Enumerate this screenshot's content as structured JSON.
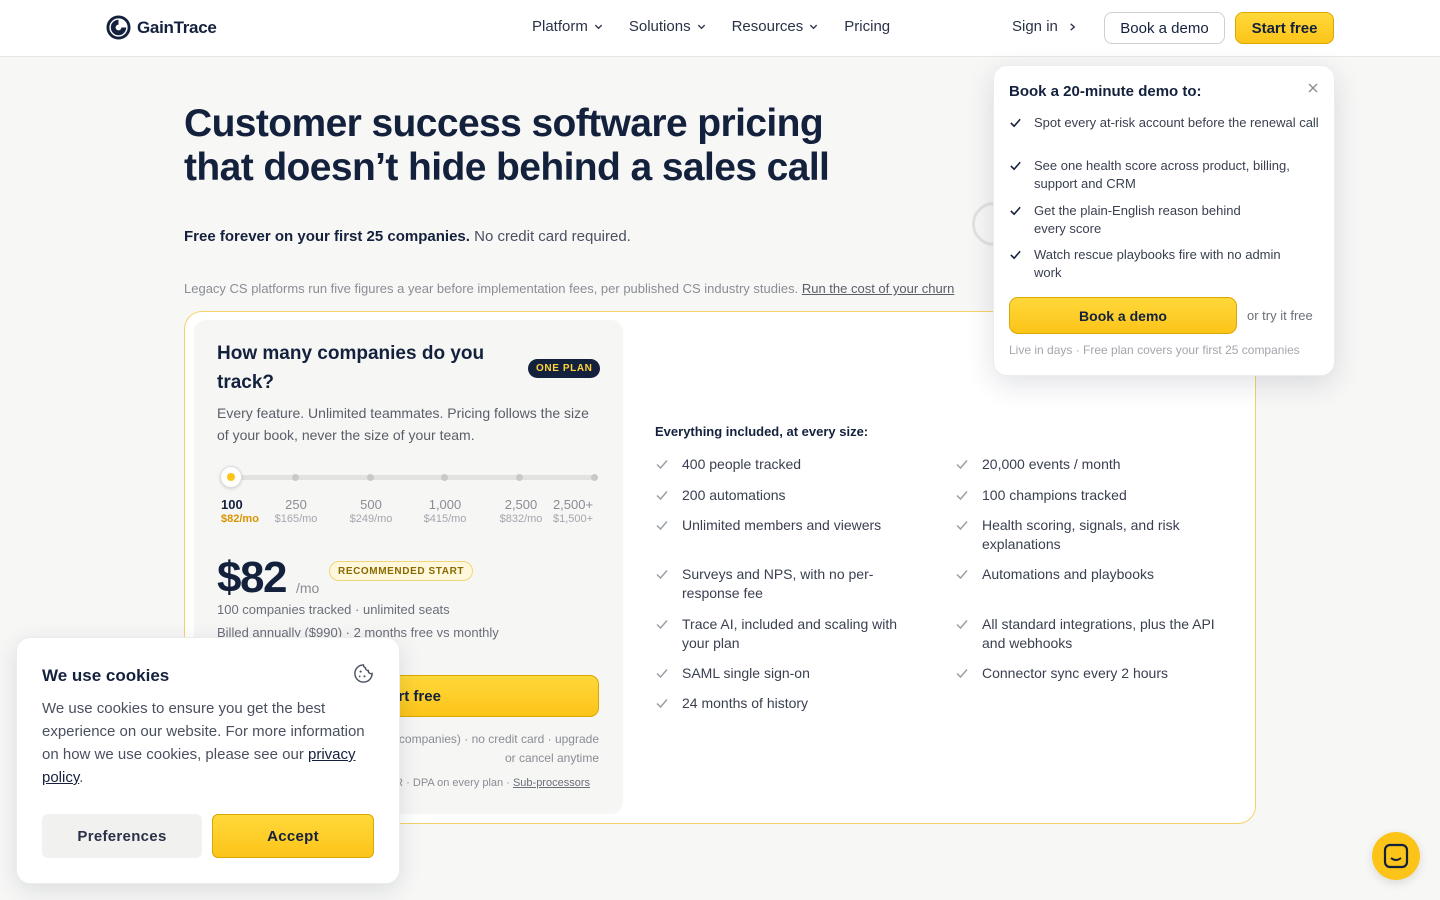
{
  "nav": {
    "brand": "GainTrace",
    "menu": [
      {
        "label": "Platform",
        "has_dropdown": true
      },
      {
        "label": "Solutions",
        "has_dropdown": true
      },
      {
        "label": "Resources",
        "has_dropdown": true
      },
      {
        "label": "Pricing",
        "has_dropdown": false
      }
    ],
    "sign_in": "Sign in",
    "book_demo": "Book a demo",
    "start_free": "Start free"
  },
  "hero": {
    "title_line1": "Customer success software pricing",
    "title_line2": "that doesn’t hide behind a sales call",
    "sub_bold": "Free forever on your first 25 companies.",
    "sub_rest": "No credit card required.",
    "note": "Legacy CS platforms run five figures a year before implementation fees, per published CS industry studies.",
    "note_link": "Run the cost of your churn"
  },
  "pricing": {
    "question": "How many companies do you track?",
    "badge": "ONE PLAN",
    "description": "Every feature. Unlimited teammates. Pricing follows the size of your book, never the size of your team.",
    "slider": {
      "selected_index": 0,
      "stops": [
        {
          "count": "100",
          "price": "$82/mo"
        },
        {
          "count": "250",
          "price": "$165/mo"
        },
        {
          "count": "500",
          "price": "$249/mo"
        },
        {
          "count": "1,000",
          "price": "$415/mo"
        },
        {
          "count": "2,500",
          "price": "$832/mo"
        },
        {
          "count": "2,500+",
          "price": "$1,500+"
        }
      ]
    },
    "price": "$82",
    "per": "/mo",
    "recommended": "RECOMMENDED START",
    "tracked_line": "100 companies tracked · unlimited seats",
    "billed_line": "Billed annually ($990) · 2 months free vs monthly",
    "cta": "Start free",
    "fine_line1": "Free plan (25 companies) · no credit card · upgrade",
    "fine_line2": "or cancel anytime",
    "fine_line3": "SOC 2 · GDPR · DPA on every plan ·",
    "fine_link": "Sub-processors",
    "included_title": "Everything included, at every size:",
    "features_left": [
      "400 people tracked",
      "200 automations",
      "Unlimited members and viewers",
      "Surveys and NPS, with no per-response fee",
      "Trace AI, included and scaling with your plan",
      "SAML single sign-on",
      "24 months of history"
    ],
    "features_right": [
      "20,000 events / month",
      "100 champions tracked",
      "Health scoring, signals, and risk explanations",
      "Automations and playbooks",
      "All standard integrations, plus the API and webhooks",
      "Connector sync every 2 hours"
    ]
  },
  "demo_popover": {
    "title": "Book a 20-minute demo to:",
    "items": [
      "Spot every at-risk account before the renewal call",
      "See one health score across product, billing, support and CRM",
      "Get the plain-English reason behind every score",
      "Watch rescue playbooks fire with no admin work"
    ],
    "cta": "Book a demo",
    "alt": "or try it free",
    "footnote": "Live in days · Free plan covers your first 25 companies"
  },
  "cookie": {
    "title": "We use cookies",
    "body": "We use cookies to ensure you get the best experience on our website. For more information on how we use cookies, please see our",
    "link": "privacy policy",
    "period": ".",
    "preferences": "Preferences",
    "accept": "Accept"
  },
  "colors": {
    "accent": "#fcc419",
    "navy": "#14213d",
    "card_border": "#f3d36a"
  }
}
